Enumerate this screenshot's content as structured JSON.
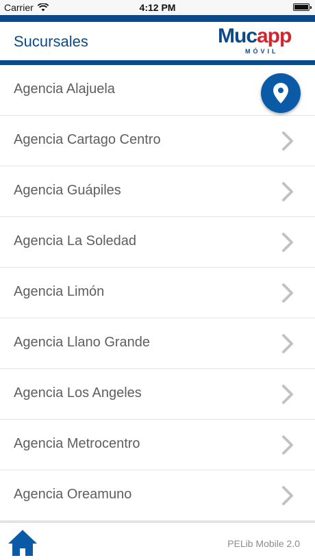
{
  "status_bar": {
    "carrier": "Carrier",
    "time": "4:12 PM",
    "wifi_icon": "wifi-icon",
    "battery_icon": "battery-icon"
  },
  "header": {
    "title": "Sucursales",
    "logo": {
      "part1": "Muc",
      "part2": "app",
      "subtitle": "MÓVIL"
    }
  },
  "branches": [
    {
      "label": "Agencia Alajuela"
    },
    {
      "label": "Agencia Cartago Centro"
    },
    {
      "label": "Agencia Guápiles"
    },
    {
      "label": "Agencia La Soledad"
    },
    {
      "label": "Agencia Limón"
    },
    {
      "label": "Agencia Llano Grande"
    },
    {
      "label": "Agencia Los Angeles"
    },
    {
      "label": "Agencia Metrocentro"
    },
    {
      "label": "Agencia Oreamuno"
    }
  ],
  "map_button": {
    "icon": "map-pin-icon"
  },
  "footer": {
    "home_icon": "home-icon",
    "version": "PELib Mobile 2.0"
  },
  "colors": {
    "brand_blue": "#0b4a8a",
    "brand_red": "#d6232c",
    "fab_blue": "#0b5aa8",
    "text_gray": "#5e5e5e"
  }
}
